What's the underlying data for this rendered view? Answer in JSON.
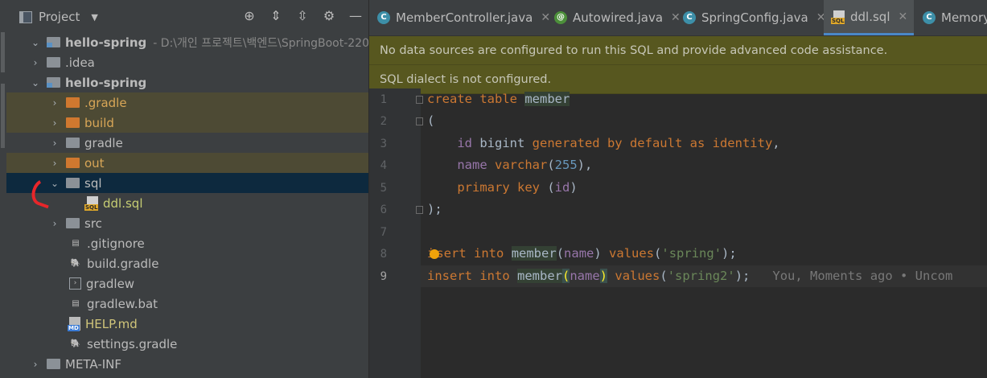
{
  "project_panel": {
    "title": "Project",
    "tree": [
      {
        "label": "hello-spring",
        "path": "- D:\\개인 프로젝트\\백엔드\\SpringBoot-220",
        "kind": "module",
        "expanded": true,
        "bold": true
      },
      {
        "label": ".idea",
        "kind": "folder",
        "expanded": false
      },
      {
        "label": "hello-spring",
        "kind": "module",
        "expanded": true,
        "bold": true
      },
      {
        "label": ".gradle",
        "kind": "folder-excluded",
        "expanded": false
      },
      {
        "label": "build",
        "kind": "folder-excluded",
        "expanded": false
      },
      {
        "label": "gradle",
        "kind": "folder",
        "expanded": false
      },
      {
        "label": "out",
        "kind": "folder-excluded",
        "expanded": false
      },
      {
        "label": "sql",
        "kind": "folder",
        "expanded": true,
        "selected": true
      },
      {
        "label": "ddl.sql",
        "kind": "sql-file"
      },
      {
        "label": "src",
        "kind": "folder",
        "expanded": false
      },
      {
        "label": ".gitignore",
        "kind": "file"
      },
      {
        "label": "build.gradle",
        "kind": "gradle-file"
      },
      {
        "label": "gradlew",
        "kind": "script-file"
      },
      {
        "label": "gradlew.bat",
        "kind": "file"
      },
      {
        "label": "HELP.md",
        "kind": "md-file"
      },
      {
        "label": "settings.gradle",
        "kind": "gradle-file"
      },
      {
        "label": "META-INF",
        "kind": "folder",
        "expanded": false
      }
    ]
  },
  "tabs": [
    {
      "label": "MemberController.java",
      "icon": "class-icon"
    },
    {
      "label": "Autowired.java",
      "icon": "annotation-icon"
    },
    {
      "label": "SpringConfig.java",
      "icon": "class-icon"
    },
    {
      "label": "ddl.sql",
      "icon": "sql-icon",
      "active": true
    },
    {
      "label": "MemoryM",
      "icon": "class-icon"
    }
  ],
  "banners": [
    "No data sources are configured to run this SQL and provide advanced code assistance.",
    "SQL dialect is not configured."
  ],
  "editor": {
    "line_numbers": [
      "1",
      "2",
      "3",
      "4",
      "5",
      "6",
      "7",
      "8",
      "9"
    ],
    "current_line": 9,
    "lines": [
      "create table member",
      "(",
      "    id bigint generated by default as identity,",
      "    name varchar(255),",
      "    primary key (id)",
      ");",
      "",
      "insert into member(name) values('spring');",
      "insert into member(name) values('spring2');"
    ],
    "inline_hint": "You, Moments ago • Uncom"
  },
  "colors": {
    "keyword": "#cc7832",
    "string": "#6a8759",
    "number": "#6897bb",
    "column": "#9876aa",
    "banner_bg": "#57571f",
    "selection": "#0d293e"
  }
}
